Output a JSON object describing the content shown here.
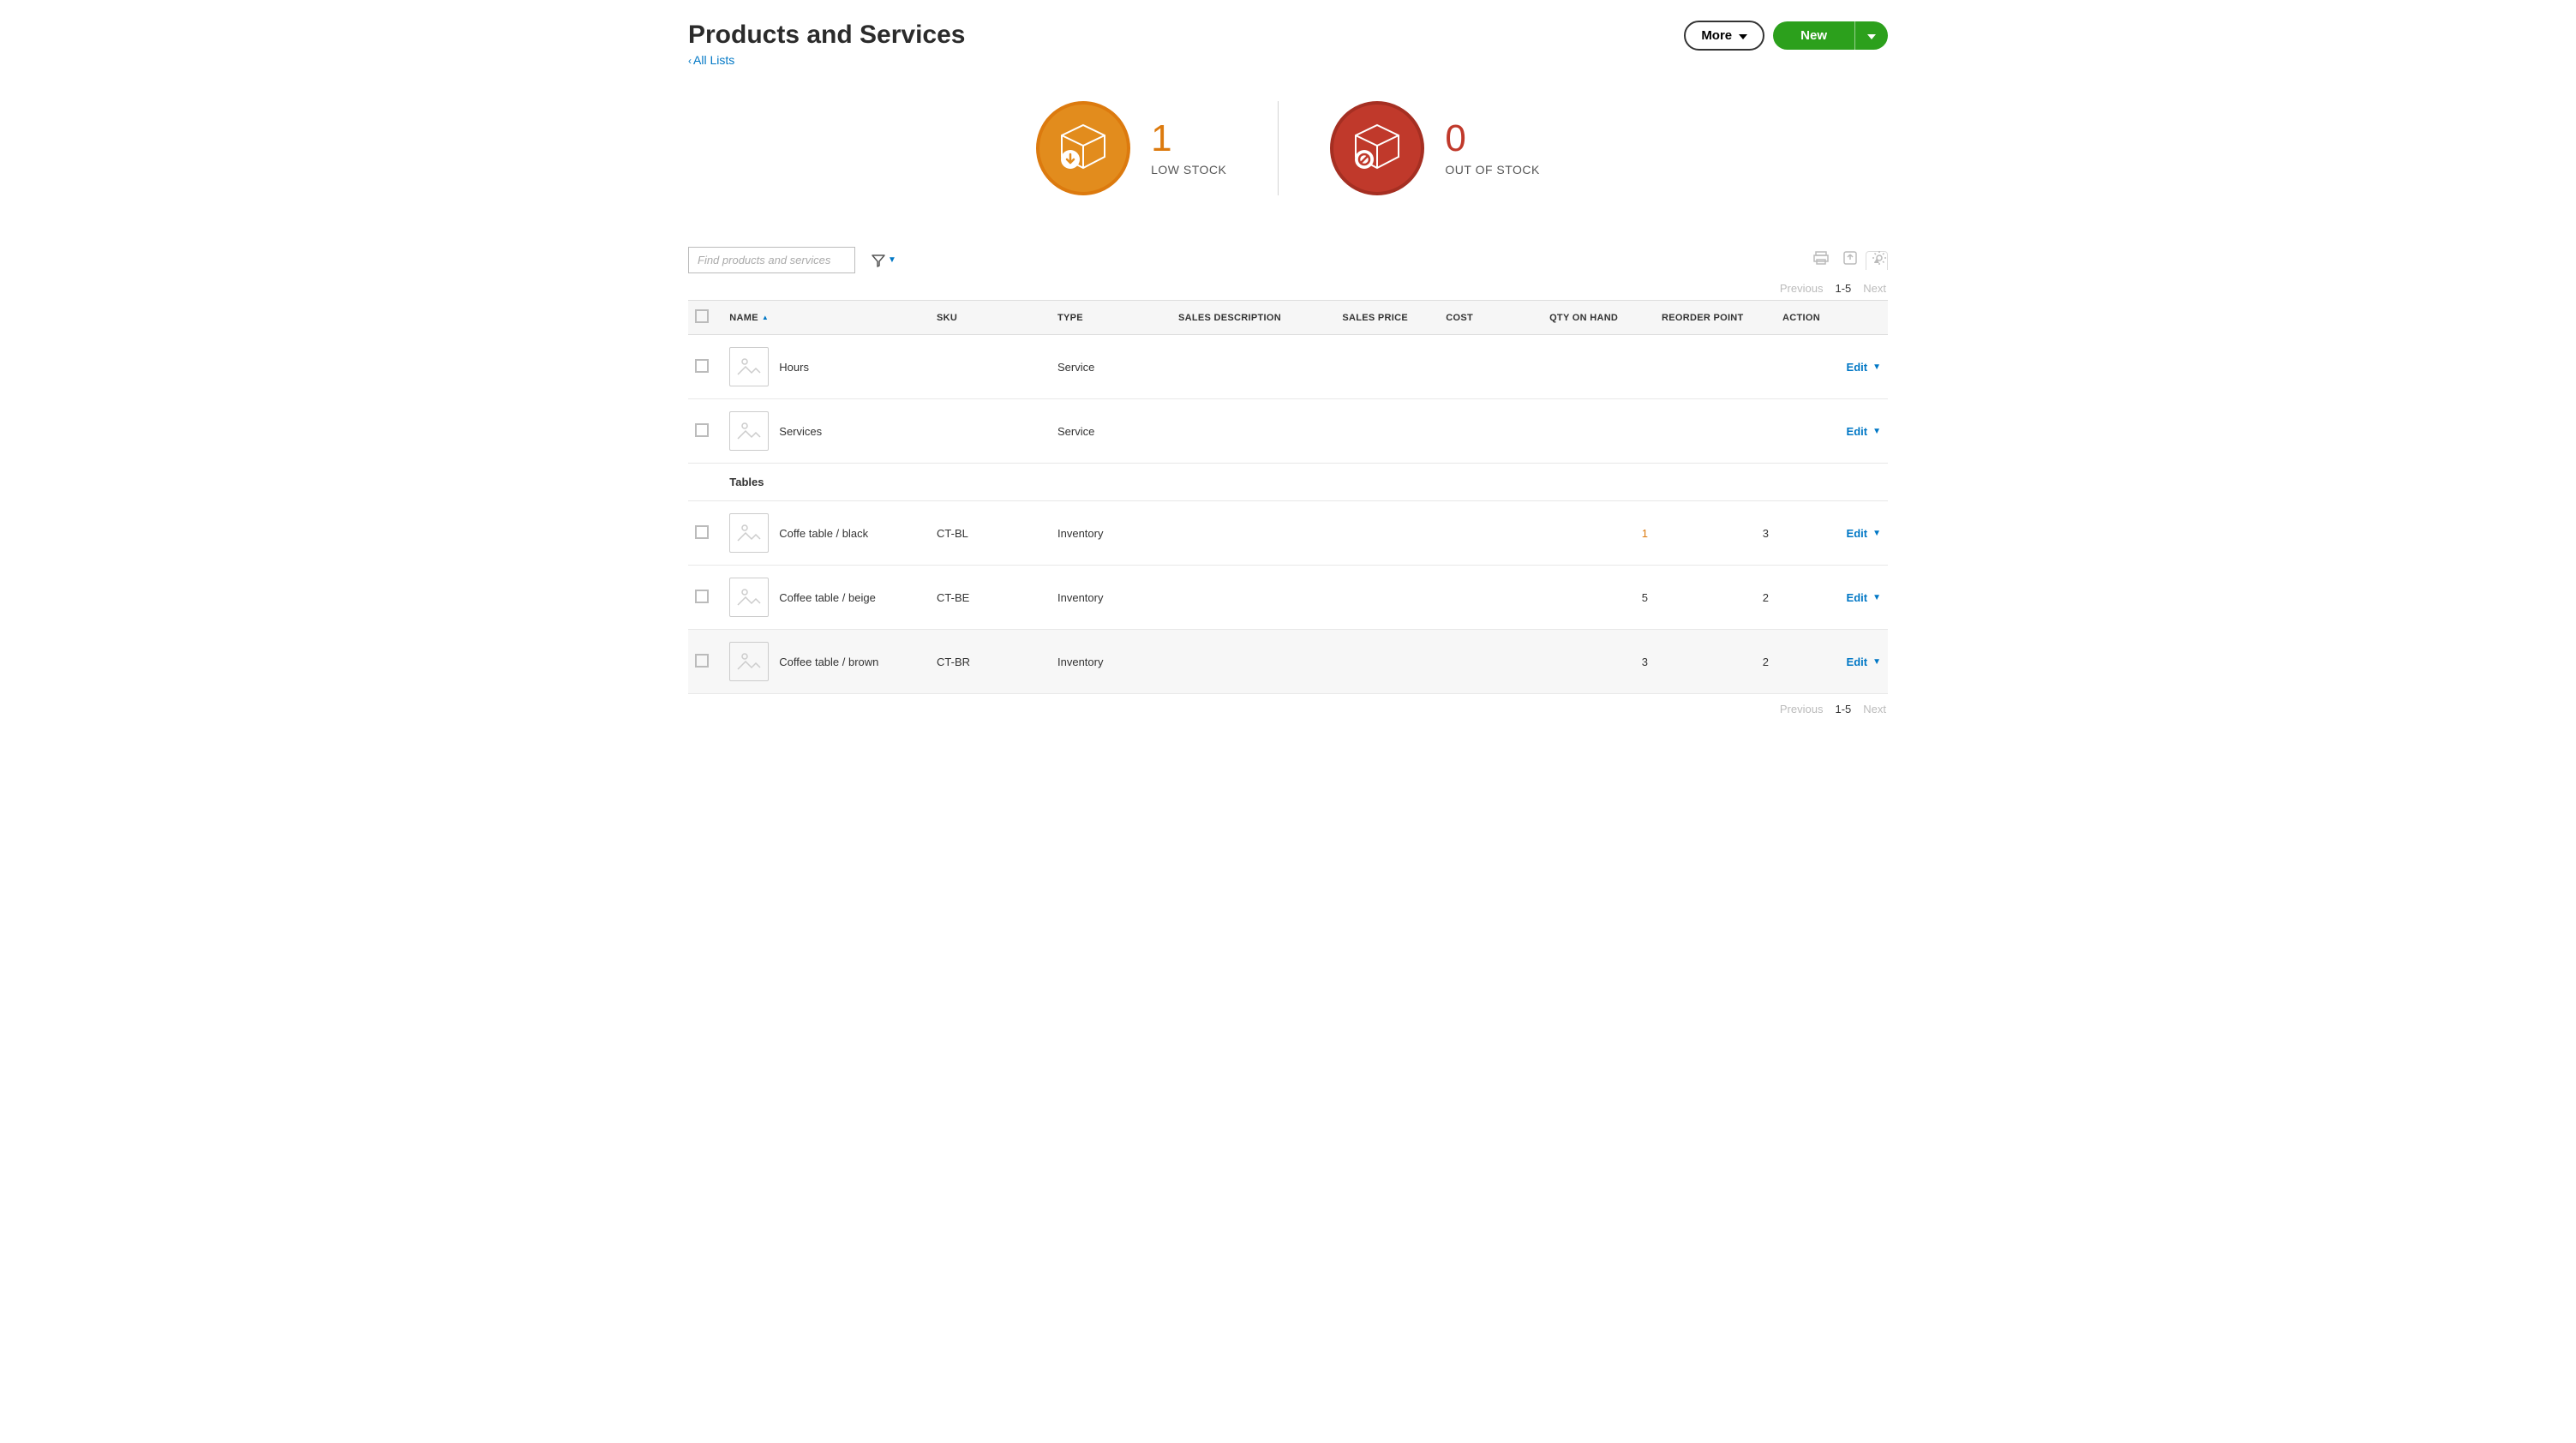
{
  "header": {
    "title": "Products and Services",
    "back_link": "All Lists",
    "more_label": "More",
    "new_label": "New"
  },
  "stats": {
    "low_stock": {
      "count": "1",
      "label": "LOW STOCK"
    },
    "out_of_stock": {
      "count": "0",
      "label": "OUT OF STOCK"
    }
  },
  "toolbar": {
    "search_placeholder": "Find products and services"
  },
  "pager": {
    "prev": "Previous",
    "range": "1-5",
    "next": "Next"
  },
  "columns": {
    "name": "NAME",
    "sku": "SKU",
    "type": "TYPE",
    "desc": "SALES DESCRIPTION",
    "price": "SALES PRICE",
    "cost": "COST",
    "qty": "QTY ON HAND",
    "reorder": "REORDER POINT",
    "action": "ACTION"
  },
  "group_label": "Tables",
  "edit_label": "Edit",
  "rows": [
    {
      "name": "Hours",
      "sku": "",
      "type": "Service",
      "desc": "",
      "price": "",
      "cost": "",
      "qty": "",
      "qty_warn": false,
      "reorder": ""
    },
    {
      "name": "Services",
      "sku": "",
      "type": "Service",
      "desc": "",
      "price": "",
      "cost": "",
      "qty": "",
      "qty_warn": false,
      "reorder": ""
    }
  ],
  "table_rows": [
    {
      "name": "Coffe table / black",
      "sku": "CT-BL",
      "type": "Inventory",
      "desc": "",
      "price": "",
      "cost": "",
      "qty": "1",
      "qty_warn": true,
      "reorder": "3",
      "hover": false
    },
    {
      "name": "Coffee table / beige",
      "sku": "CT-BE",
      "type": "Inventory",
      "desc": "",
      "price": "",
      "cost": "",
      "qty": "5",
      "qty_warn": false,
      "reorder": "2",
      "hover": false
    },
    {
      "name": "Coffee table / brown",
      "sku": "CT-BR",
      "type": "Inventory",
      "desc": "",
      "price": "",
      "cost": "",
      "qty": "3",
      "qty_warn": false,
      "reorder": "2",
      "hover": true
    }
  ]
}
